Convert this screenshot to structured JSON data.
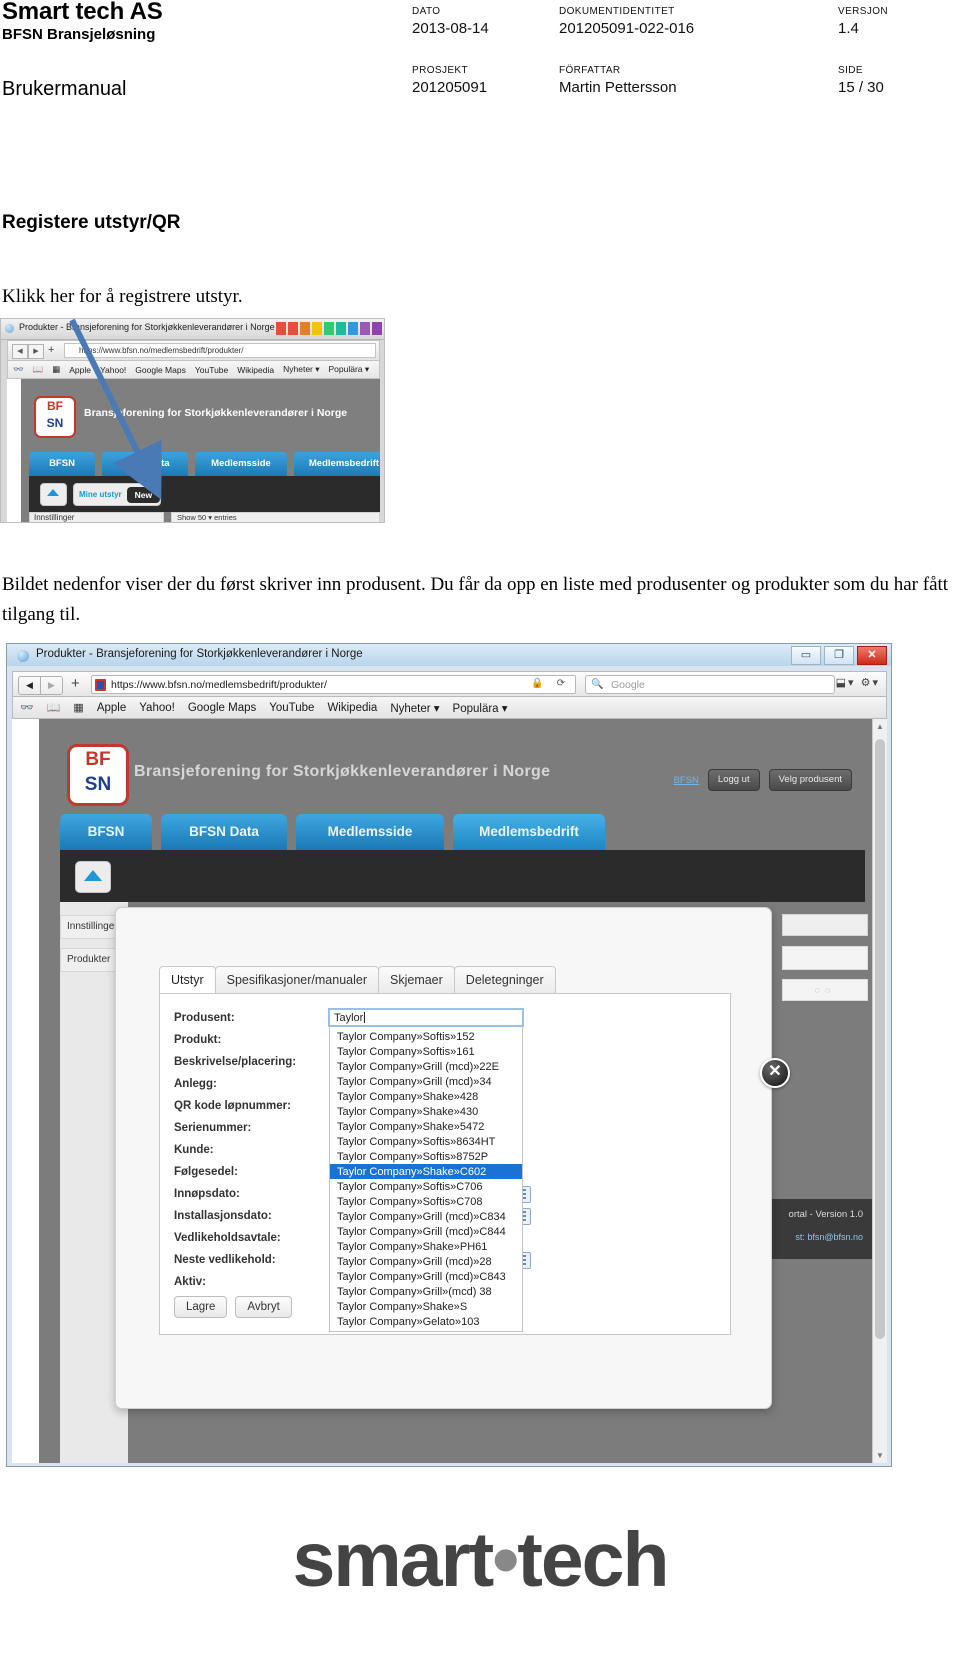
{
  "doc_header": {
    "company": "Smart tech AS",
    "subtitle": "BFSN Bransjeløsning",
    "manual": "Brukermanual",
    "fields": [
      {
        "label": "DATO",
        "value": "2013-08-14"
      },
      {
        "label": "DOKUMENTIDENTITET",
        "value": "201205091-022-016"
      },
      {
        "label": "VERSJON",
        "value": "1.4"
      },
      {
        "label": "PROSJEKT",
        "value": "201205091"
      },
      {
        "label": "FÖRFATTAR",
        "value": "Martin Pettersson"
      },
      {
        "label": "SIDE",
        "value": "15 / 30"
      }
    ]
  },
  "content": {
    "heading": "Registere utstyr/QR",
    "paragraph1": "Klikk her for å registrere utstyr.",
    "paragraph2": "Bildet nedenfor viser der du først skriver inn produsent.  Du får da opp en liste med produsenter og produkter som du har fått tilgang til."
  },
  "shot1": {
    "window_title": "Produkter - Bransjeforening for Storkjøkkenleverandører i Norge",
    "url": "https://www.bfsn.no/medlemsbedrift/produkter/",
    "bookmarks": [
      "Apple",
      "Yahoo!",
      "Google Maps",
      "YouTube",
      "Wikipedia",
      "Nyheter ▾",
      "Populära ▾"
    ],
    "site_brand": "Bransjeforening for Storkjøkkenleverandører i Norge",
    "logo_top": "BF",
    "logo_bottom": "SN",
    "nav_tabs": [
      "BFSN",
      "BFSN Data",
      "Medlemsside",
      "Medlemsbedrift"
    ],
    "toolbar_mine": "Mine utstyr",
    "toolbar_new": "New",
    "panel_settings": "Innstillinger",
    "table_show": "Show  50 ▾  entries"
  },
  "shot2": {
    "window_title": "Produkter - Bransjeforening for Storkjøkkenleverandører i Norge",
    "window_buttons": [
      "▭",
      "❐",
      "✕"
    ],
    "url": "https://www.bfsn.no/medlemsbedrift/produkter/",
    "url_icons": "🔒 ⟳",
    "search_placeholder": "Google",
    "bookmarks": [
      "Apple",
      "Yahoo!",
      "Google Maps",
      "YouTube",
      "Wikipedia",
      "Nyheter ▾",
      "Populära ▾"
    ],
    "site_brand": "Bransjeforening for Storkjøkkenleverandører i Norge",
    "logo_top": "BF",
    "logo_bottom": "SN",
    "top_links": {
      "bfsn": "BFSN",
      "logout": "Logg ut",
      "choose": "Velg produsent"
    },
    "nav_tabs": [
      "BFSN",
      "BFSN Data",
      "Medlemsside",
      "Medlemsbedrift"
    ],
    "sidebar": [
      "Innstillinger",
      "Produkter"
    ],
    "footer_line1": "ortal - Version 1.0",
    "footer_line2": "st: bfsn@bfsn.no",
    "modal": {
      "close_label": "✕",
      "tabs": [
        "Utstyr",
        "Spesifikasjoner/manualer",
        "Skjemaer",
        "Deletegninger"
      ],
      "active_tab": "Utstyr",
      "fields": [
        "Produsent:",
        "Produkt:",
        "Beskrivelse/placering:",
        "Anlegg:",
        "QR kode løpnummer:",
        "Serienummer:",
        "Kunde:",
        "Følgesedel:",
        "Innøpsdato:",
        "Installasjonsdato:",
        "Vedlikeholdsavtale:",
        "Neste vedlikehold:",
        "Aktiv:"
      ],
      "buttons": {
        "save": "Lagre",
        "cancel": "Avbryt"
      },
      "autocomplete": {
        "input_value": "Taylor",
        "selected": "Taylor Company»Shake»C602",
        "options": [
          "Taylor Company»Softis»152",
          "Taylor Company»Softis»161",
          "Taylor Company»Grill (mcd)»22E",
          "Taylor Company»Grill (mcd)»34",
          "Taylor Company»Shake»428",
          "Taylor Company»Shake»430",
          "Taylor Company»Shake»5472",
          "Taylor Company»Softis»8634HT",
          "Taylor Company»Softis»8752P",
          "Taylor Company»Shake»C602",
          "Taylor Company»Softis»C706",
          "Taylor Company»Softis»C708",
          "Taylor Company»Grill (mcd)»C834",
          "Taylor Company»Grill (mcd)»C844",
          "Taylor Company»Shake»PH61",
          "Taylor Company»Grill (mcd)»28",
          "Taylor Company»Grill (mcd)»C843",
          "Taylor Company»Grill»(mcd) 38",
          "Taylor Company»Shake»S",
          "Taylor Company»Gelato»103"
        ]
      }
    }
  },
  "brand_footer": {
    "text_main": "smart",
    "dot": "•",
    "text_second": "tech"
  },
  "colors": {
    "accent_blue": "#1f7ab5",
    "select_blue": "#1a73d4",
    "logo_red": "#c0392b",
    "logo_blue": "#1f3f8f"
  }
}
